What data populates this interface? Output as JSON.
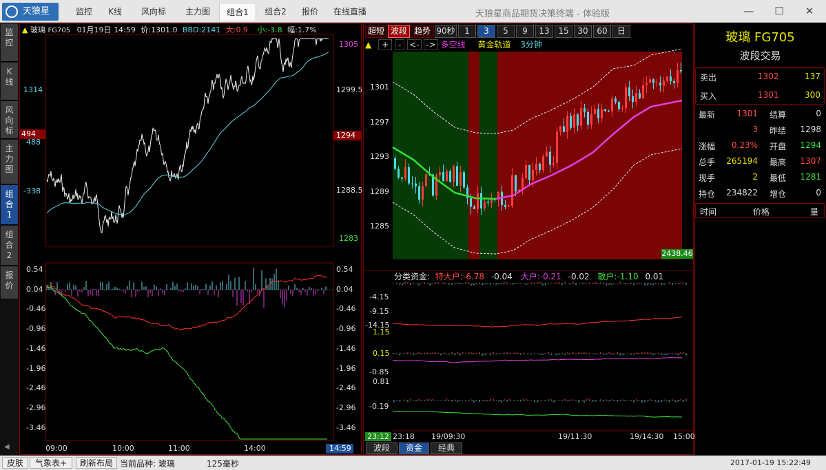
{
  "titlebar": {
    "logo_label": "天狼星",
    "tabs": [
      "监控",
      "K线",
      "风向标",
      "主力图",
      "组合1",
      "组合2",
      "报价",
      "在线直播"
    ],
    "active_tab": 4,
    "app_title": "天狼星商品期货决策终端 - 体验版"
  },
  "side_tabs": [
    "监控",
    "K线",
    "风向标",
    "主力图",
    "组合1",
    "组合2",
    "报价"
  ],
  "left_chart": {
    "header": {
      "name": "玻璃",
      "code": "FG705",
      "date": "01月19日",
      "time": "14:59",
      "price": "价:1301.0",
      "bbd": "BBD:2141",
      "big": "大:0.9",
      "small": "小:-3.8",
      "amplitude": "幅:1.7%"
    },
    "price_axis_right": [
      "1305",
      "1299.5",
      "1294",
      "1288.5",
      "1283"
    ],
    "price_axis_left": [
      "1314",
      "494",
      "488",
      "-338"
    ],
    "right_highlight": "1294",
    "left_highlight": "494",
    "flow_axis": [
      "0.54",
      "0.04",
      "-0.46",
      "-0.96",
      "-1.46",
      "-1.96",
      "-2.46",
      "-2.96",
      "-3.46"
    ],
    "time_axis": [
      "09:00",
      "10:00",
      "11:00",
      "14:00"
    ],
    "time_highlight": "14:59"
  },
  "mid_chart": {
    "mode_buttons": [
      "超短",
      "波段",
      "趋势"
    ],
    "active_mode": 1,
    "timeframes": [
      "90秒",
      "1",
      "3",
      "5",
      "9",
      "13",
      "15",
      "30",
      "60",
      "日"
    ],
    "active_timeframe": 2,
    "toolbar": {
      "up": "▲",
      "plus": "+",
      "minus": "-",
      "prev": "<-",
      "next": "->",
      "indicator1": "多空线",
      "indicator2": "黄金轨道",
      "period": "3分钟"
    },
    "price_axis": [
      "1301",
      "1297",
      "1293",
      "1289",
      "1285"
    ],
    "volume_label": "2438.46",
    "fund_header": {
      "title": "分类资金:",
      "special_label": "特大户:",
      "special_val": "-6.78",
      "special_delta": "-0.04",
      "big_label": "大户:",
      "big_val": "-0.21",
      "big_delta": "-0.02",
      "retail_label": "散户:",
      "retail_val": "-1.10",
      "retail_delta": "0.01"
    },
    "fund_axis": [
      "-4.15",
      "-9.15",
      "-14.15",
      "1.15",
      "0.15",
      "-0.85",
      "0.81",
      "-0.19"
    ],
    "time_axis_highlight": "23:12",
    "time_axis": [
      "23:18",
      "19/09:30",
      "19/11:30",
      "19/14:30",
      "15:00"
    ],
    "bottom_tabs": [
      "波段",
      "资金",
      "经典"
    ],
    "active_bottom_tab": 1
  },
  "quote": {
    "title": "玻璃 FG705",
    "subtitle": "波段交易",
    "sell": {
      "label": "卖出",
      "price": "1302",
      "volume": "137"
    },
    "buy": {
      "label": "买入",
      "price": "1301",
      "volume": "300"
    },
    "rows": [
      {
        "l1": "最新",
        "v1": "1301",
        "c1": "#ff4a4a",
        "l2": "结算",
        "v2": "0",
        "c2": "#ddd"
      },
      {
        "l1": "",
        "v1": "3",
        "c1": "#ff4a4a",
        "l2": "昨结",
        "v2": "1298",
        "c2": "#ddd"
      },
      {
        "l1": "涨幅",
        "v1": "0.23%",
        "c1": "#ff4a4a",
        "l2": "开盘",
        "v2": "1294",
        "c2": "#3fe23f"
      },
      {
        "l1": "总手",
        "v1": "265194",
        "c1": "#e8e800",
        "l2": "最高",
        "v2": "1307",
        "c2": "#ff4a4a"
      },
      {
        "l1": "现手",
        "v1": "2",
        "c1": "#e8e800",
        "l2": "最低",
        "v2": "1281",
        "c2": "#3fe23f"
      },
      {
        "l1": "持仓",
        "v1": "234822",
        "c1": "#ddd",
        "l2": "增仓",
        "v2": "0",
        "c2": "#ddd"
      }
    ],
    "trade_headers": [
      "时间",
      "价格",
      "量"
    ]
  },
  "statusbar": {
    "skin": "皮肤",
    "weather": "气象表+",
    "refresh_layout": "刷新布局",
    "current": "当前品种: 玻璃",
    "latency": "125毫秒",
    "datetime": "2017-01-19  15:22:49"
  },
  "colors": {
    "up": "#ff4a4a",
    "down": "#3fe23f",
    "cyan": "#5fd6e6",
    "magenta": "#e040e0",
    "accent": "#1e4f96",
    "bull_zone": "#7b0505",
    "bear_zone": "#063a06"
  }
}
